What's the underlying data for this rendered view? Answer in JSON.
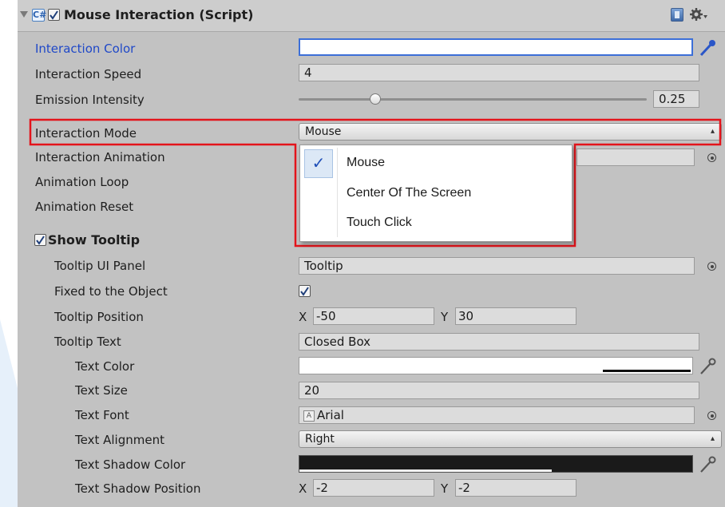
{
  "component": {
    "title": "Mouse Interaction (Script)",
    "icons": [
      "collapse-arrow-icon",
      "script-icon",
      "help-book-icon",
      "gear-icon"
    ]
  },
  "props": {
    "interaction_color": {
      "label": "Interaction Color",
      "value": "#ffffff"
    },
    "interaction_speed": {
      "label": "Interaction Speed",
      "value": "4"
    },
    "emission_intensity": {
      "label": "Emission Intensity",
      "value": "0.25",
      "slider_fraction": 0.22
    },
    "interaction_mode": {
      "label": "Interaction Mode",
      "value": "Mouse"
    },
    "interaction_animation": {
      "label": "Interaction Animation"
    },
    "animation_loop": {
      "label": "Animation Loop"
    },
    "animation_reset": {
      "label": "Animation Reset"
    },
    "show_tooltip": {
      "label": "Show Tooltip",
      "checked": true
    },
    "tooltip_ui_panel": {
      "label": "Tooltip UI Panel",
      "value": "Tooltip"
    },
    "fixed_to_object": {
      "label": "Fixed to the Object",
      "checked": true
    },
    "tooltip_position": {
      "label": "Tooltip Position",
      "x_label": "X",
      "x": "-50",
      "y_label": "Y",
      "y": "30"
    },
    "tooltip_text": {
      "label": "Tooltip Text",
      "value": "Closed Box"
    },
    "text_color": {
      "label": "Text Color",
      "value": "#ffffff"
    },
    "text_size": {
      "label": "Text Size",
      "value": "20"
    },
    "text_font": {
      "label": "Text Font",
      "value": "Arial"
    },
    "text_alignment": {
      "label": "Text Alignment",
      "value": "Right"
    },
    "text_shadow_color": {
      "label": "Text Shadow Color",
      "value": "#1a1a1a"
    },
    "text_shadow_position": {
      "label": "Text Shadow Position",
      "x_label": "X",
      "x": "-2",
      "y_label": "Y",
      "y": "-2"
    }
  },
  "mode_menu": {
    "options": [
      "Mouse",
      "Center Of The Screen",
      "Touch Click"
    ],
    "selected": "Mouse",
    "check_glyph": "✓"
  },
  "colors": {
    "highlight_red": "#e3141b",
    "label_blue": "#1f48c8",
    "panel_gray": "#c2c2c2",
    "backdrop_blue": "#e7f1fb"
  }
}
